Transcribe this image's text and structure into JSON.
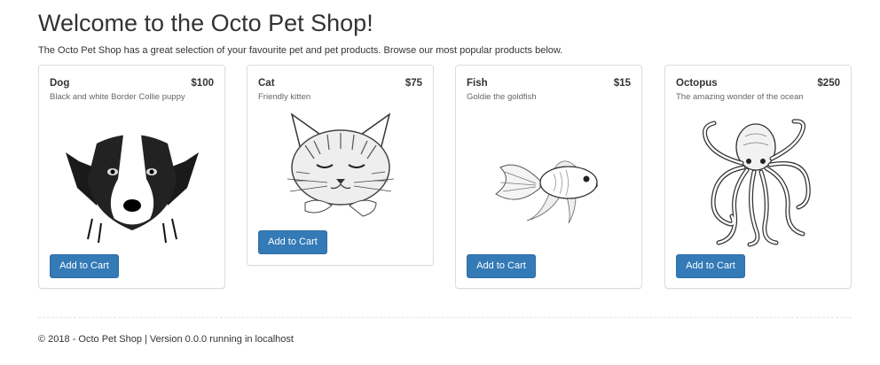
{
  "header": {
    "title": "Welcome to the Octo Pet Shop!",
    "intro": "The Octo Pet Shop has a great selection of your favourite pet and pet products. Browse our most popular products below."
  },
  "products": [
    {
      "name": "Dog",
      "price": "$100",
      "description": "Black and white Border Collie puppy",
      "image_icon": "dog-illustration",
      "button_label": "Add to Cart"
    },
    {
      "name": "Cat",
      "price": "$75",
      "description": "Friendly kitten",
      "image_icon": "cat-illustration",
      "button_label": "Add to Cart"
    },
    {
      "name": "Fish",
      "price": "$15",
      "description": "Goldie the goldfish",
      "image_icon": "goldfish-illustration",
      "button_label": "Add to Cart"
    },
    {
      "name": "Octopus",
      "price": "$250",
      "description": "The amazing wonder of the ocean",
      "image_icon": "octopus-illustration",
      "button_label": "Add to Cart"
    }
  ],
  "footer": {
    "text": "© 2018 - Octo Pet Shop | Version 0.0.0 running in localhost"
  },
  "colors": {
    "button": "#337ab7",
    "button_border": "#2e6da4",
    "card_border": "#dddddd",
    "text": "#333333"
  }
}
